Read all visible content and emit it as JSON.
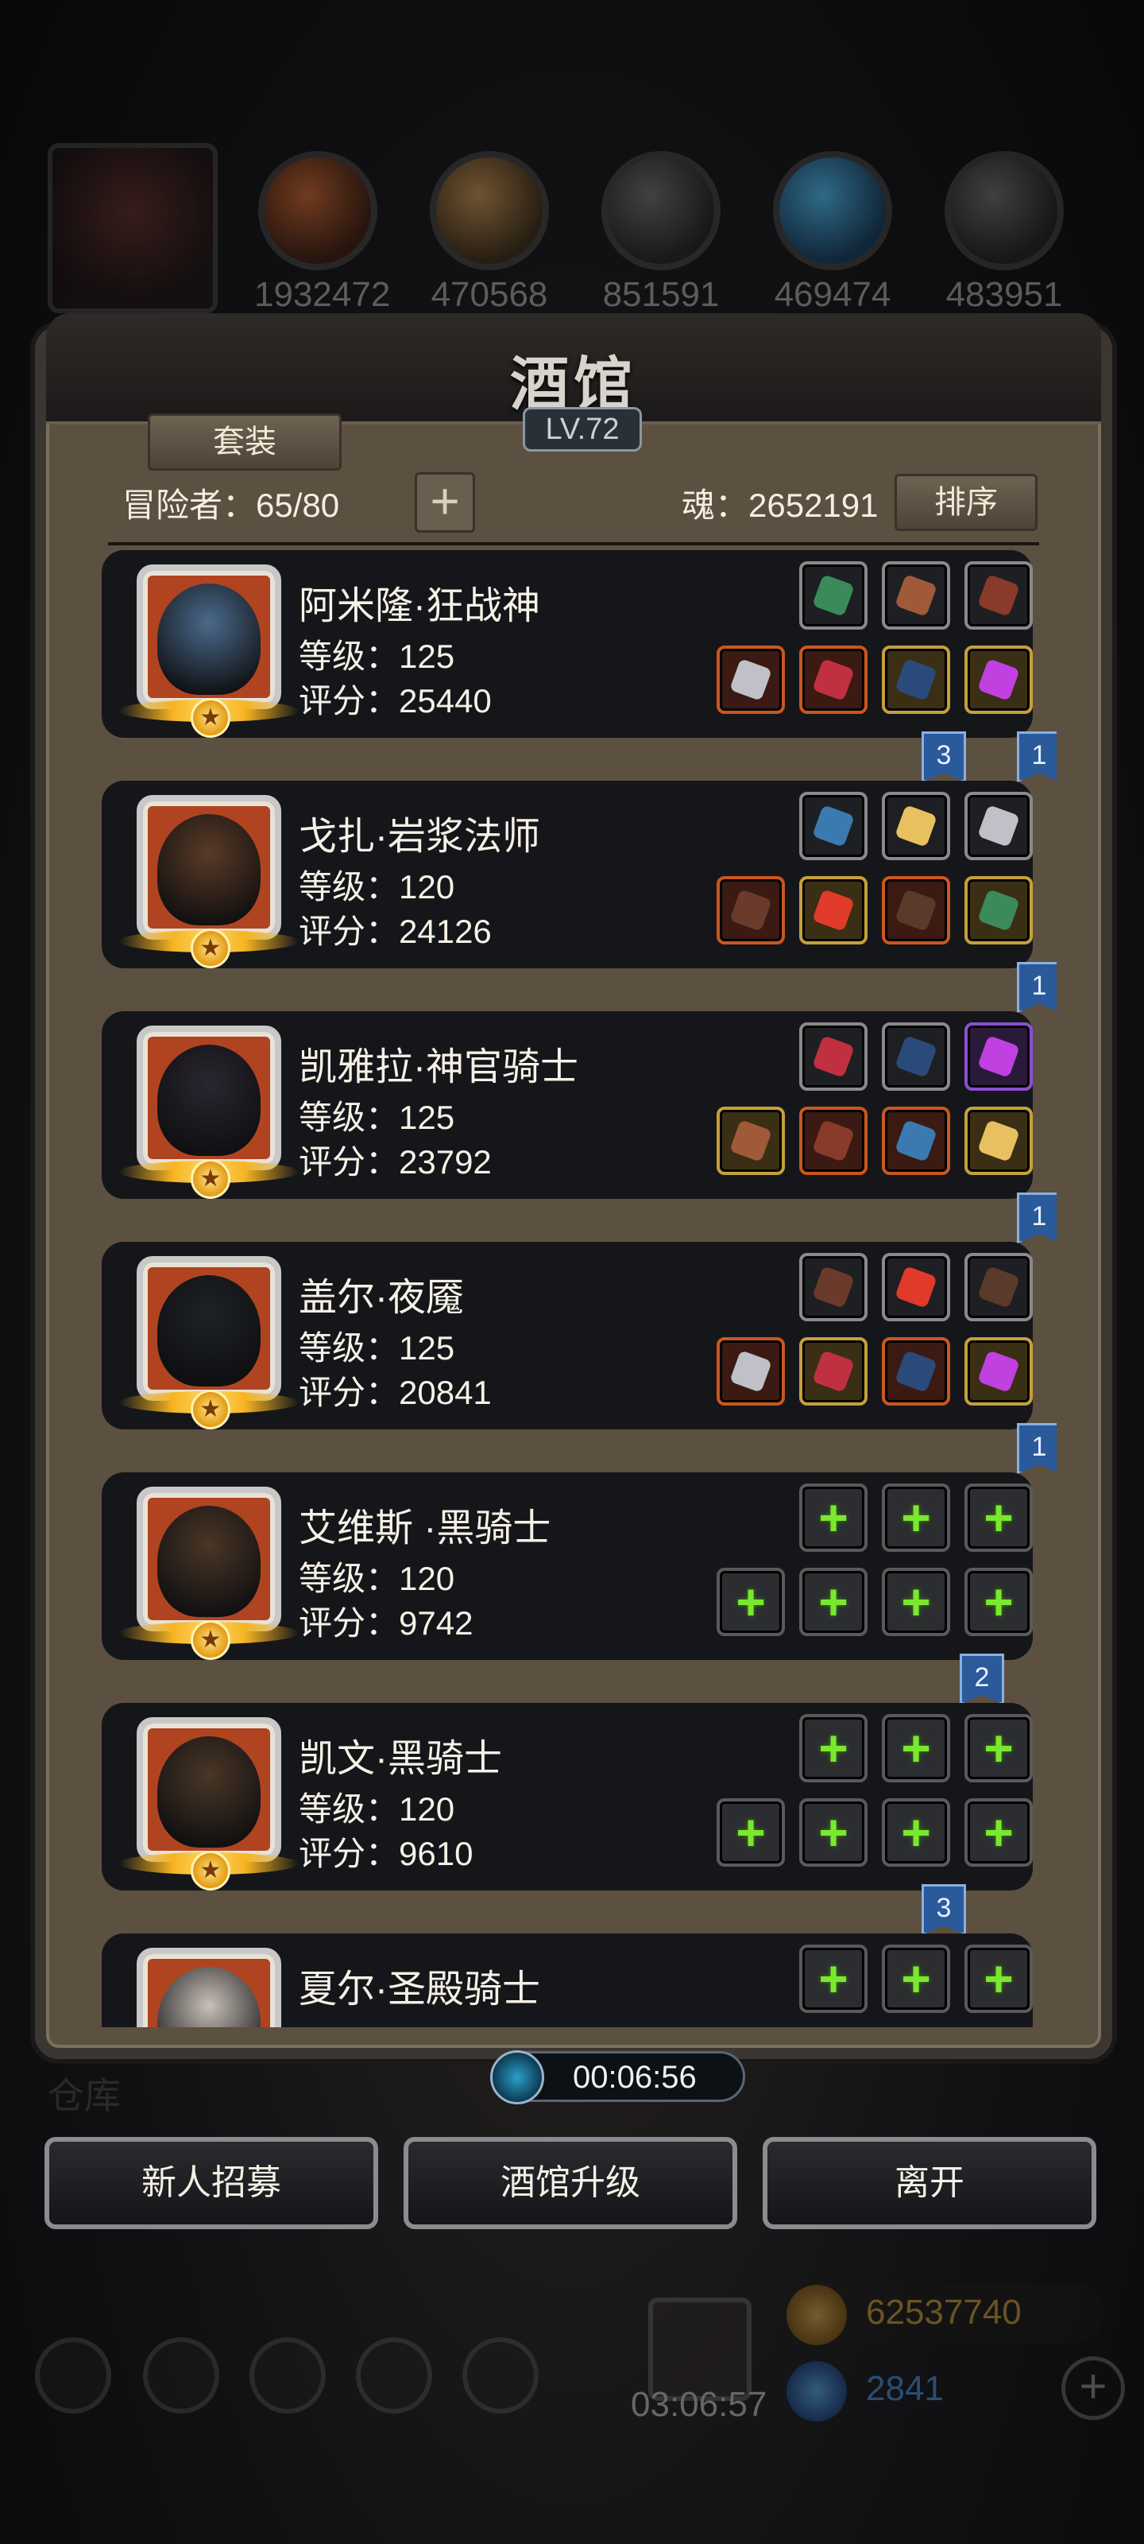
{
  "topbar": {
    "resources": [
      {
        "icon": "meat-icon",
        "value": "1932472"
      },
      {
        "icon": "wood-icon",
        "value": "470568"
      },
      {
        "icon": "iron-icon",
        "value": "851591"
      },
      {
        "icon": "crystal-icon",
        "value": "469474"
      },
      {
        "icon": "stone-icon",
        "value": "483951"
      }
    ]
  },
  "dialog": {
    "title": "酒馆",
    "level": "LV.72",
    "suit_button": "套装",
    "adventurers_label": "冒险者：65/80",
    "add_label": "+",
    "soul_label": "魂：2652191",
    "sort_button": "排序"
  },
  "heroes": [
    {
      "name": "阿米隆·狂战神",
      "level": "等级：125",
      "score": "评分：25440",
      "tags": [
        {
          "value": "3"
        },
        {
          "value": "1"
        }
      ],
      "face": "#4a6a8a"
    },
    {
      "name": "戈扎·岩浆法师",
      "level": "等级：120",
      "score": "评分：24126",
      "tags": [
        {
          "value": "1"
        }
      ],
      "face": "#5a3a26"
    },
    {
      "name": "凯雅拉·神官骑士",
      "level": "等级：125",
      "score": "评分：23792",
      "tags": [
        {
          "value": "1"
        }
      ],
      "face": "#2a2630"
    },
    {
      "name": "盖尔·夜魇",
      "level": "等级：125",
      "score": "评分：20841",
      "tags": [
        {
          "value": "1"
        }
      ],
      "face": "#1e2226"
    },
    {
      "name": "艾维斯 ·黑骑士",
      "level": "等级：120",
      "score": "评分：9742",
      "tags": [
        {
          "value": "2"
        }
      ],
      "face": "#4a3626"
    },
    {
      "name": "凯文·黑骑士",
      "level": "等级：120",
      "score": "评分：9610",
      "tags": [
        {
          "value": "3"
        }
      ],
      "face": "#4a3626"
    },
    {
      "name": "夏尔·圣殿骑士",
      "level": "",
      "score": "",
      "tags": [],
      "face": "#c8c0b8"
    }
  ],
  "timer": {
    "value": "00:06:56"
  },
  "buttons": {
    "recruit": "新人招募",
    "upgrade": "酒馆升级",
    "leave": "离开"
  },
  "hud": {
    "gift_timer": "03:06:57",
    "gold": "62537740",
    "gems": "2841",
    "warehouse": "仓库"
  },
  "colors": {
    "plus_green": "#7be830",
    "tag_blue": "#2a5a9a",
    "frame": "#5c5040"
  }
}
